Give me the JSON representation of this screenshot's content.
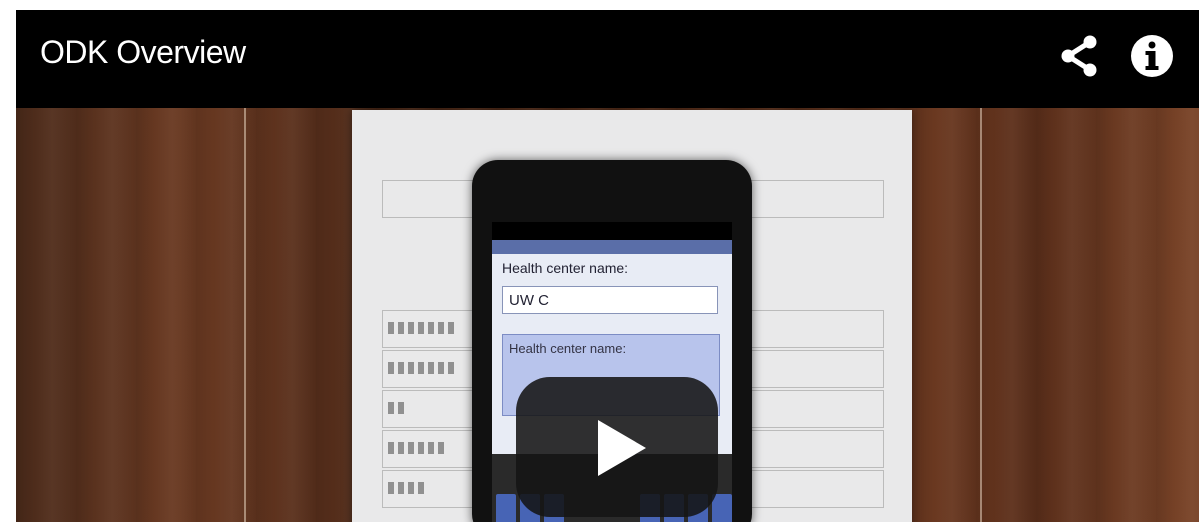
{
  "player": {
    "title": "ODK Overview",
    "icons": {
      "share": "share-icon",
      "info": "info-icon",
      "play": "play-icon"
    }
  },
  "video_frame": {
    "phone_screen": {
      "field_label": "Health center name:",
      "field_value": "UW C",
      "suggestion_label": "Health center name:"
    }
  },
  "colors": {
    "titlebar": "#000000",
    "title_text": "#ffffff",
    "play_button": "#141414"
  }
}
